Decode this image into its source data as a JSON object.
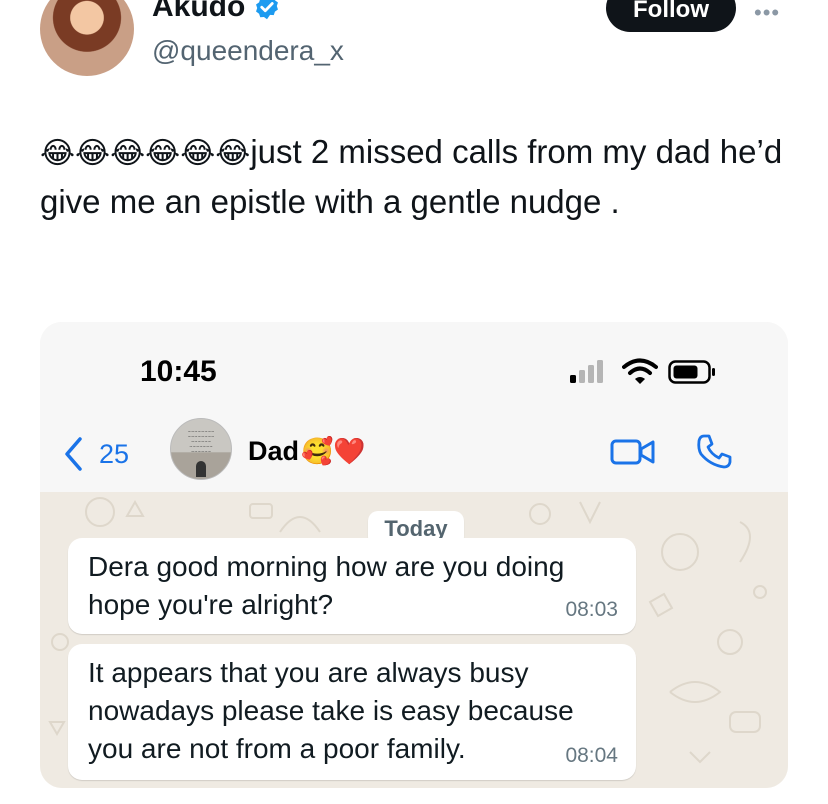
{
  "tweet": {
    "display_name": "Akudo",
    "handle": "@queendera_x",
    "follow_label": "Follow",
    "emojis": "😂😂😂😂😂😂",
    "text": "just 2 missed calls from my dad he’d give me an epistle with a gentle nudge ."
  },
  "embedded_screenshot": {
    "status_bar": {
      "time": "10:45"
    },
    "chat_header": {
      "back_count": "25",
      "contact_name": "Dad",
      "contact_emojis": "🥰❤️"
    },
    "date_separator": "Today",
    "messages": [
      {
        "text": "Dera  good morning how are you doing\nhope you're alright?",
        "time": "08:03"
      },
      {
        "text": "It appears that you are always busy\nnowadays  please  take is easy  because\nyou are not from a  poor family.",
        "time": "08:04"
      }
    ]
  },
  "colors": {
    "verified_blue": "#1d9bf0",
    "follow_bg": "#0f1419",
    "link_blue": "#1a73e8",
    "chat_wallpaper": "#efeae2",
    "bubble": "#ffffff"
  },
  "icons": [
    "verified-badge-icon",
    "more-icon",
    "signal-icon",
    "wifi-icon",
    "battery-icon",
    "back-chevron-icon",
    "video-call-icon",
    "phone-call-icon"
  ]
}
